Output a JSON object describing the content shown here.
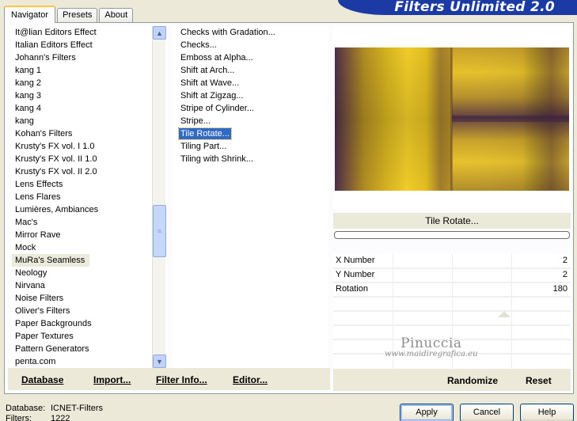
{
  "tabs": [
    {
      "label": "Navigator",
      "active": true
    },
    {
      "label": "Presets",
      "active": false
    },
    {
      "label": "About",
      "active": false
    }
  ],
  "banner": {
    "title": "Filters Unlimited 2.0"
  },
  "categories": {
    "items": [
      "It@lian Editors Effect",
      "Italian Editors Effect",
      "Johann's Filters",
      "kang 1",
      "kang 2",
      "kang 3",
      "kang 4",
      "kang",
      "Kohan's Filters",
      "Krusty's FX vol. I 1.0",
      "Krusty's FX vol. II 1.0",
      "Krusty's FX vol. II 2.0",
      "Lens Effects",
      "Lens Flares",
      "Lumières, Ambiances",
      "Mac's",
      "Mirror Rave",
      "Mock",
      "MuRa's Seamless",
      "Neology",
      "Nirvana",
      "Noise Filters",
      "Oliver's Filters",
      "Paper Backgrounds",
      "Paper Textures",
      "Pattern Generators",
      "penta.com"
    ],
    "selected_index": 18
  },
  "filters": {
    "items": [
      "Checks with Gradation...",
      "Checks...",
      "Emboss at Alpha...",
      "Shift at Arch...",
      "Shift at Wave...",
      "Shift at Zigzag...",
      "Stripe of Cylinder...",
      "Stripe...",
      "Tile Rotate...",
      "Tiling Part...",
      "Tiling with Shrink..."
    ],
    "selected_index": 8
  },
  "left_buttons": {
    "database": "Database",
    "import": "Import...",
    "filter_info": "Filter Info...",
    "editor": "Editor..."
  },
  "filter_name": "Tile Rotate...",
  "progress": 0,
  "params": [
    {
      "label": "X Number",
      "value": "2"
    },
    {
      "label": "Y Number",
      "value": "2"
    },
    {
      "label": "Rotation",
      "value": "180"
    }
  ],
  "watermark": {
    "main": "Pinuccia",
    "sub": "www.maidiregrafica.eu"
  },
  "right_buttons": {
    "randomize": "Randomize",
    "reset": "Reset"
  },
  "footer": {
    "database_label": "Database:",
    "database_value": "ICNET-Filters",
    "filters_label": "Filters:",
    "filters_value": "1222"
  },
  "dialog_buttons": {
    "apply": "Apply",
    "cancel": "Cancel",
    "help": "Help"
  },
  "colors": {
    "accent": "#316ac5",
    "banner": "#1c3aa3",
    "preview_gold": "#d8b41c",
    "preview_purple": "#4a2c4a"
  }
}
